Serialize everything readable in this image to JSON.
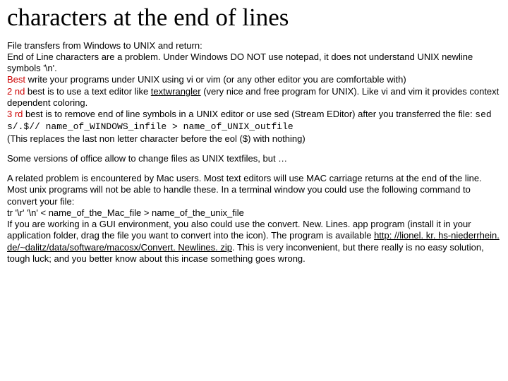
{
  "title": "characters at the end of lines",
  "para1": {
    "l1": "File transfers from Windows to UNIX and return:",
    "l2": "End of Line characters are a problem. Under Windows DO NOT use notepad, it does not understand UNIX newline symbols '\\n'.",
    "best_label": "Best",
    "l3": " write your programs under UNIX using vi or vim (or any other editor you are comfortable with)",
    "second_label": "2 nd",
    "l4a": " best is to use a text editor like ",
    "link1_text": "textwrangler",
    "l4b": " (very nice and free program for UNIX). Like vi and vim it provides context dependent coloring.",
    "third_label": "3 rd",
    "l5a": " best is to remove end of line symbols in a UNIX editor or use sed (Stream EDitor) after you transferred the file: ",
    "code": "sed s/.$// name_of_WINDOWS_infile > name_of_UNIX_outfile",
    "l6": " (This replaces the last non letter character before the eol ($) with nothing)"
  },
  "para2": "Some versions of office allow to change files as UNIX textfiles, but …",
  "para3": {
    "l1": "A related problem is encountered by Mac users. Most text editors will use MAC carriage returns at the end of the line. Most unix programs will not be able to handle these. In a terminal window you could use the following command to convert your file:",
    "l2": "tr '\\r' '\\n' < name_of_the_Mac_file > name_of_the_unix_file",
    "l3a": "If you are working in a GUI environment, you also could use the convert. New. Lines. app program (install it in your application folder, drag the file you want to convert into the icon). The program is available ",
    "link2_text": "http: //lionel. kr. hs-niederrhein. de/~dalitz/data/software/macosx/Convert. Newlines. zip",
    "l3b": ".  This is very inconvenient, but there really is no easy solution, tough luck; and you better know about this incase something goes wrong."
  }
}
